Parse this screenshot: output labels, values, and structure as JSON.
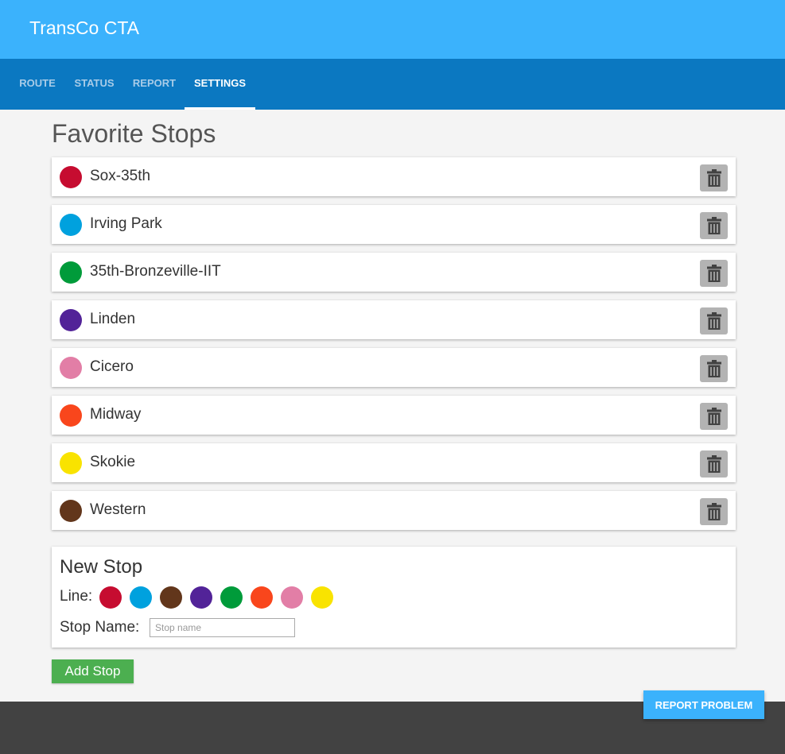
{
  "app": {
    "title": "TransCo CTA"
  },
  "tabs": [
    {
      "label": "ROUTE",
      "active": false
    },
    {
      "label": "STATUS",
      "active": false
    },
    {
      "label": "REPORT",
      "active": false
    },
    {
      "label": "SETTINGS",
      "active": true
    }
  ],
  "page": {
    "title": "Favorite Stops"
  },
  "favorites": [
    {
      "name": "Sox-35th",
      "color": "#c60c30"
    },
    {
      "name": "Irving Park",
      "color": "#00a1de"
    },
    {
      "name": "35th-Bronzeville-IIT",
      "color": "#009b3a"
    },
    {
      "name": "Linden",
      "color": "#522398"
    },
    {
      "name": "Cicero",
      "color": "#e27ea6"
    },
    {
      "name": "Midway",
      "color": "#f9461c"
    },
    {
      "name": "Skokie",
      "color": "#f9e300"
    },
    {
      "name": "Western",
      "color": "#62361b"
    }
  ],
  "new_stop": {
    "title": "New Stop",
    "line_label": "Line:",
    "line_colors": [
      "#c60c30",
      "#00a1de",
      "#62361b",
      "#522398",
      "#009b3a",
      "#f9461c",
      "#e27ea6",
      "#f9e300"
    ],
    "name_label": "Stop Name:",
    "name_placeholder": "Stop name",
    "name_value": ""
  },
  "actions": {
    "add_stop": "Add Stop",
    "report_problem": "REPORT PROBLEM"
  },
  "colors": {
    "appbar": "#3bb2fc",
    "tabbar": "#0b78c1",
    "delete_button": "#b3b3b3",
    "add_button": "#4caf50",
    "footer": "#424242"
  }
}
